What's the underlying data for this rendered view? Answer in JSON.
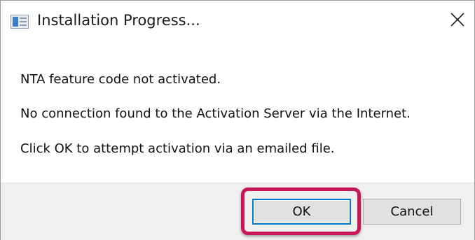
{
  "window": {
    "title": "Installation Progress...",
    "app_icon": "app-icon",
    "close_icon": "close-icon"
  },
  "message": {
    "line1": "NTA feature code not activated.",
    "line2": "No connection found to the Activation Server via the Internet.",
    "line3": "Click OK to attempt activation via an emailed file."
  },
  "buttons": {
    "ok_label": "OK",
    "cancel_label": "Cancel"
  },
  "colors": {
    "highlight": "#c8175a",
    "focus_border": "#0078d7",
    "footer_bg": "#f0f0f0"
  }
}
